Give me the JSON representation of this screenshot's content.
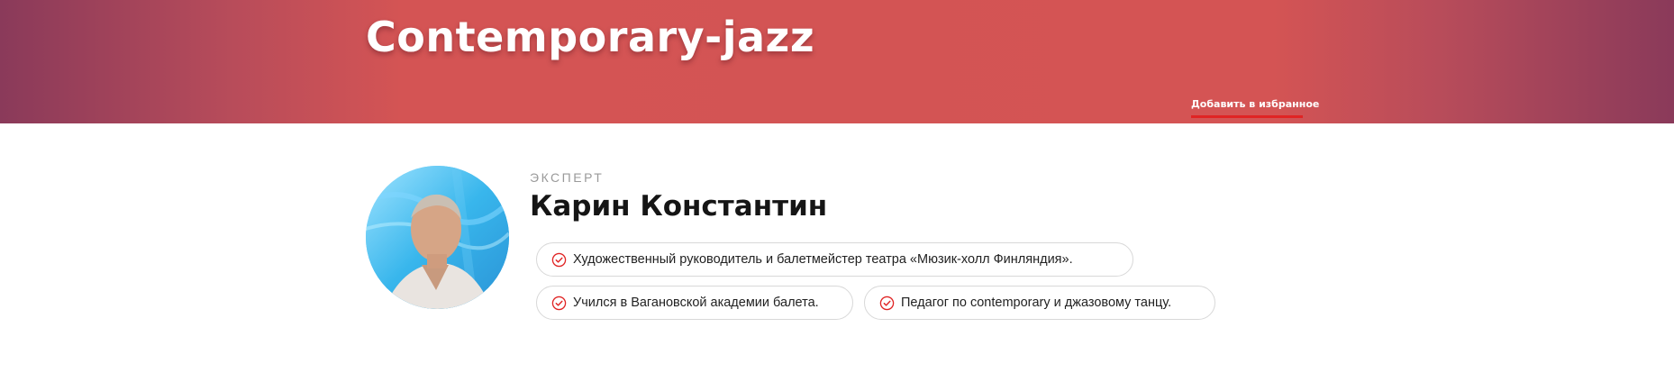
{
  "banner": {
    "title": "Contemporary-jazz",
    "favorite_link": "Добавить в избранное",
    "accent_color": "#d35454",
    "underline_color": "#e02424"
  },
  "expert": {
    "role": "ЭКСПЕРТ",
    "name": "Карин Константин",
    "avatar_icon": "expert-photo",
    "facts": [
      {
        "icon": "check-circle-icon",
        "text": "Художественный руководитель и балетмейстер театра «Мюзик-холл Финляндия»."
      },
      {
        "icon": "check-circle-icon",
        "text": "Учился в Вагановской академии балета."
      },
      {
        "icon": "check-circle-icon",
        "text": "Педагог по contemporary и джазовому танцу."
      }
    ]
  }
}
